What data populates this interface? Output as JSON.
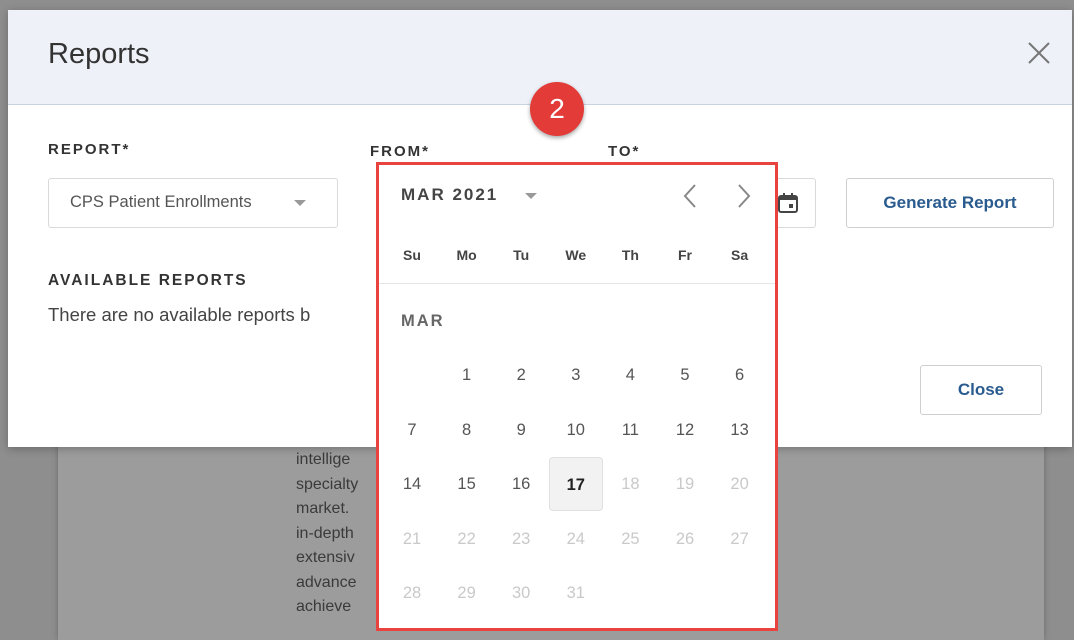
{
  "modal": {
    "title": "Reports",
    "report_label": "REPORT*",
    "report_value": "CPS Patient Enrollments",
    "from_label": "FROM*",
    "to_label": "TO*",
    "generate_label": "Generate Report",
    "available_title": "AVAILABLE REPORTS",
    "available_message": "There are no available reports b",
    "close_label": "Close"
  },
  "background_text": [
    "intellige",
    "specialty",
    "market.",
    "in-depth",
    "extensiv",
    "advance",
    "achieve"
  ],
  "step_badge": "2",
  "datepicker": {
    "month_label": "MAR 2021",
    "section_label": "MAR",
    "weekdays": [
      "Su",
      "Mo",
      "Tu",
      "We",
      "Th",
      "Fr",
      "Sa"
    ],
    "start_weekday": 1,
    "days_in_month": 31,
    "selected_day": 17,
    "last_enabled_day": 17
  },
  "colors": {
    "highlight_border": "#e8433f",
    "badge": "#e23b38",
    "button_text": "#2a5b8f",
    "header_bg": "#eef2f8"
  },
  "icons": [
    "close-icon",
    "calendar-icon",
    "chevron-left-icon",
    "chevron-right-icon",
    "caret-down-icon"
  ]
}
